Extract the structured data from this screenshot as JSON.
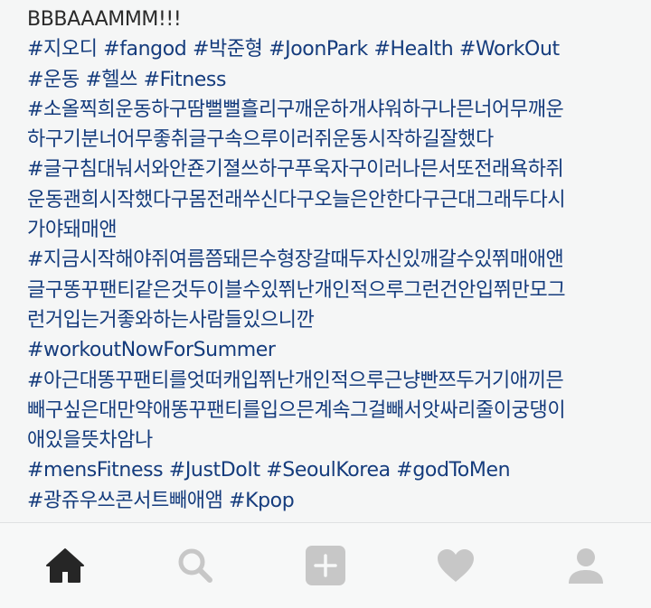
{
  "caption": {
    "lines": [
      [
        {
          "text": "BBBAAAMMM!!!",
          "type": "plain"
        }
      ],
      [
        {
          "text": "#지오디",
          "type": "hashtag"
        },
        {
          "text": " ",
          "type": "plain"
        },
        {
          "text": "#fangod",
          "type": "hashtag"
        },
        {
          "text": " ",
          "type": "plain"
        },
        {
          "text": "#박준형",
          "type": "hashtag"
        },
        {
          "text": " ",
          "type": "plain"
        },
        {
          "text": "#JoonPark",
          "type": "hashtag"
        },
        {
          "text": " ",
          "type": "plain"
        },
        {
          "text": "#Health",
          "type": "hashtag"
        },
        {
          "text": " ",
          "type": "plain"
        },
        {
          "text": "#WorkOut",
          "type": "hashtag"
        }
      ],
      [
        {
          "text": "#운동",
          "type": "hashtag"
        },
        {
          "text": " ",
          "type": "plain"
        },
        {
          "text": "#헬쓰",
          "type": "hashtag"
        },
        {
          "text": " ",
          "type": "plain"
        },
        {
          "text": "#Fitness",
          "type": "hashtag"
        }
      ],
      [
        {
          "text": "#소올찍희운동하구땀뻘뻘흘리구깨운하개샤워하구나믄너어무깨운",
          "type": "hashtag"
        }
      ],
      [
        {
          "text": "하구기분너어무좋취글구속으루이러쥐운동시작하길잘했다",
          "type": "hashtag"
        }
      ],
      [
        {
          "text": "#글구침대눠서와안죤기졀쓰하구푸욱자구이러나믄서또전래욕하쥐",
          "type": "hashtag"
        }
      ],
      [
        {
          "text": "운동괜희시작했다구몸전래쑤신다구오늘은안한다구근대그래두다시",
          "type": "hashtag"
        }
      ],
      [
        {
          "text": "가야돼매앤",
          "type": "hashtag"
        }
      ],
      [
        {
          "text": "#지금시작해야쥐여름쯤돼믄수형장갈때두자신있깨갈수있쮜매애앤",
          "type": "hashtag"
        }
      ],
      [
        {
          "text": "글구똥꾸팬티같은것두이블수있쮜난개인적으루그런건안입쮜만모그",
          "type": "hashtag"
        }
      ],
      [
        {
          "text": "런거입는거좋와하는사람들있으니깐",
          "type": "hashtag"
        }
      ],
      [
        {
          "text": "#workoutNowForSummer",
          "type": "hashtag"
        }
      ],
      [
        {
          "text": "#아근대똥꾸팬티를엇떠캐입쮜난개인적으루근냥빤쯔두거기애끼믄",
          "type": "hashtag"
        }
      ],
      [
        {
          "text": "빼구싶은대만약애똥꾸팬티를입으믄계속그걸빼서앗싸리줄이궁댕이",
          "type": "hashtag"
        }
      ],
      [
        {
          "text": "애있을뜻차암나",
          "type": "hashtag"
        }
      ],
      [
        {
          "text": "#mensFitness",
          "type": "hashtag"
        },
        {
          "text": " ",
          "type": "plain"
        },
        {
          "text": "#JustDoIt",
          "type": "hashtag"
        },
        {
          "text": " ",
          "type": "plain"
        },
        {
          "text": "#SeoulKorea",
          "type": "hashtag"
        },
        {
          "text": " ",
          "type": "plain"
        },
        {
          "text": "#godToMen",
          "type": "hashtag"
        }
      ],
      [
        {
          "text": "#광쥬우쓰콘서트빼애앰",
          "type": "hashtag"
        },
        {
          "text": " ",
          "type": "plain"
        },
        {
          "text": "#Kpop",
          "type": "hashtag"
        }
      ]
    ]
  },
  "tabbar": {
    "items": [
      {
        "name": "tab-home",
        "icon": "home-icon",
        "active": true
      },
      {
        "name": "tab-search",
        "icon": "search-icon",
        "active": false
      },
      {
        "name": "tab-new-post",
        "icon": "plus-square-icon",
        "active": false
      },
      {
        "name": "tab-activity",
        "icon": "heart-icon",
        "active": false
      },
      {
        "name": "tab-profile",
        "icon": "profile-icon",
        "active": false
      }
    ]
  },
  "colors": {
    "background": "#f5f6f6",
    "text": "#2a2a2a",
    "hashtag": "#153c7d",
    "icon_active": "#262626",
    "icon_inactive": "#c7c7c7"
  }
}
